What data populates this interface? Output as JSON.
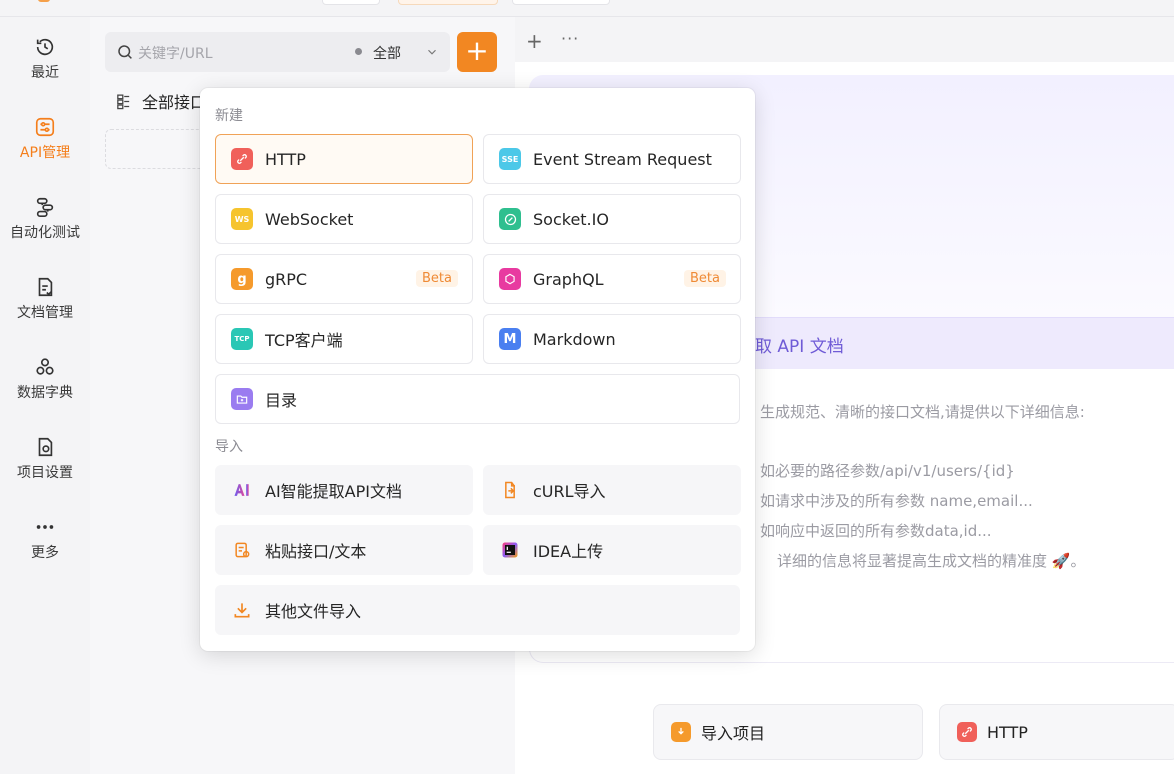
{
  "sidebar": {
    "items": [
      {
        "label": "最近",
        "icon": "history-icon"
      },
      {
        "label": "API管理",
        "icon": "api-management-icon",
        "active": true
      },
      {
        "label": "自动化测试",
        "icon": "automation-test-icon"
      },
      {
        "label": "文档管理",
        "icon": "document-icon"
      },
      {
        "label": "数据字典",
        "icon": "data-dictionary-icon"
      },
      {
        "label": "项目设置",
        "icon": "project-settings-icon"
      },
      {
        "label": "更多",
        "icon": "more-icon"
      }
    ]
  },
  "list": {
    "search_placeholder": "关键字/URL",
    "filter": "全部",
    "add_label": "+",
    "root_label": "全部接口"
  },
  "tabs": {
    "add": "+",
    "more": "···"
  },
  "main": {
    "banner_text": "取 API 文档",
    "desc_lines": [
      "生成规范、清晰的接口文档,请提供以下详细信息:",
      "如必要的路径参数/api/v1/users/{id}",
      "如请求中涉及的所有参数 name,email...",
      "如响应中返回的所有参数data,id...",
      "详细的信息将显著提高生成文档的精准度 🚀。"
    ],
    "quick": [
      {
        "label": "导入项目",
        "icon": "import-project-icon"
      },
      {
        "label": "HTTP",
        "icon": "http-icon"
      }
    ]
  },
  "popup": {
    "new_title": "新建",
    "import_title": "导入",
    "new_items": [
      {
        "label": "HTTP",
        "icon": "http-icon",
        "color": "#f0605a",
        "glyph": "⟲"
      },
      {
        "label": "Event Stream Request",
        "icon": "sse-icon",
        "color": "#4cc8e8",
        "glyph": "SSE"
      },
      {
        "label": "WebSocket",
        "icon": "websocket-icon",
        "color": "#f6c42e",
        "glyph": "WS"
      },
      {
        "label": "Socket.IO",
        "icon": "socketio-icon",
        "color": "#2fbf8f",
        "glyph": "⊘"
      },
      {
        "label": "gRPC",
        "icon": "grpc-icon",
        "color": "#f59a2c",
        "glyph": "g",
        "badge": "Beta"
      },
      {
        "label": "GraphQL",
        "icon": "graphql-icon",
        "color": "#e83aa0",
        "glyph": "✱",
        "badge": "Beta"
      },
      {
        "label": "TCP客户端",
        "icon": "tcp-client-icon",
        "color": "#2ac7b5",
        "glyph": "TCP"
      },
      {
        "label": "Markdown",
        "icon": "markdown-icon",
        "color": "#4a7ff0",
        "glyph": "M"
      },
      {
        "label": "目录",
        "icon": "folder-icon",
        "color": "#9a7cf0",
        "glyph": "+"
      }
    ],
    "import_items": [
      {
        "label": "AI智能提取API文档",
        "icon": "ai-extract-icon"
      },
      {
        "label": "cURL导入",
        "icon": "curl-import-icon"
      },
      {
        "label": "粘贴接口/文本",
        "icon": "paste-text-icon"
      },
      {
        "label": "IDEA上传",
        "icon": "idea-upload-icon"
      },
      {
        "label": "其他文件导入",
        "icon": "file-import-icon"
      }
    ]
  }
}
